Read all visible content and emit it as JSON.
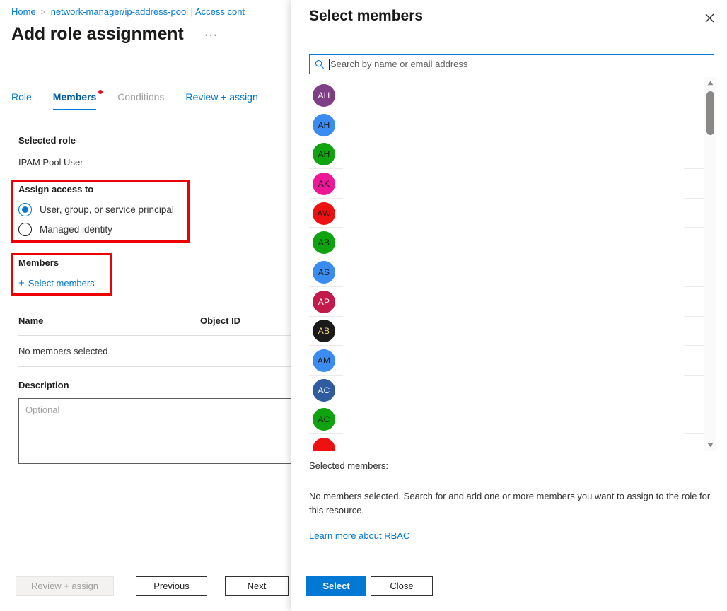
{
  "base_blade": {
    "breadcrumb": {
      "home": "Home",
      "separator": ">",
      "current": "network-manager/ip-address-pool | Access cont"
    },
    "title": "Add role assignment",
    "ellipsis": "···",
    "tabs": [
      {
        "label": "Role",
        "state": "enabled"
      },
      {
        "label": "Members",
        "state": "active"
      },
      {
        "label": "Conditions",
        "state": "disabled"
      },
      {
        "label": "Review + assign",
        "state": "enabled"
      }
    ],
    "selected_role": {
      "heading": "Selected role",
      "value": "IPAM Pool User"
    },
    "assign_access_to": {
      "heading": "Assign access to",
      "options": [
        {
          "label": "User, group, or service principal",
          "selected": true
        },
        {
          "label": "Managed identity",
          "selected": false
        }
      ]
    },
    "members_section": {
      "heading": "Members",
      "add_link": "Select members",
      "plus": "+"
    },
    "members_table": {
      "columns": [
        "Name",
        "Object ID"
      ],
      "empty_text": "No members selected"
    },
    "description": {
      "label": "Description",
      "placeholder": "Optional",
      "value": ""
    },
    "footer": {
      "review_assign": "Review + assign",
      "previous": "Previous",
      "next": "Next"
    }
  },
  "flyout": {
    "title": "Select members",
    "close_icon": "close-icon",
    "search": {
      "placeholder": "Search by name or email address",
      "value": ""
    },
    "people": [
      {
        "initials": "AH",
        "color": "#7e3f86",
        "text_color": "#ffffff"
      },
      {
        "initials": "AH",
        "color": "#3b8cf0",
        "text_color": "#1b1a19"
      },
      {
        "initials": "AH",
        "color": "#0fa30f",
        "text_color": "#1b1a19"
      },
      {
        "initials": "AK",
        "color": "#ee1798",
        "text_color": "#1b1a19"
      },
      {
        "initials": "AW",
        "color": "#ef1111",
        "text_color": "#1b1a19"
      },
      {
        "initials": "AB",
        "color": "#0fa30f",
        "text_color": "#1b1a19"
      },
      {
        "initials": "AS",
        "color": "#3b8cf0",
        "text_color": "#1b1a19"
      },
      {
        "initials": "AP",
        "color": "#c3194b",
        "text_color": "#ffffff"
      },
      {
        "initials": "AB",
        "color": "#1a1a1a",
        "text_color": "#f3d48a"
      },
      {
        "initials": "AM",
        "color": "#3b8cf0",
        "text_color": "#1b1a19"
      },
      {
        "initials": "AC",
        "color": "#2f5c9e",
        "text_color": "#ffffff"
      },
      {
        "initials": "AC",
        "color": "#0fa30f",
        "text_color": "#1b1a19"
      },
      {
        "initials": "",
        "color": "#ef1111",
        "text_color": "#ffffff"
      }
    ],
    "selected_members_label": "Selected members:",
    "selected_members_body": "No members selected. Search for and add one or more members you want to assign to the role for this resource.",
    "learn_more": "Learn more about RBAC",
    "footer": {
      "select": "Select",
      "close": "Close"
    }
  },
  "annotations": {
    "highlight_color": "#ec0000",
    "boxes": [
      "assign-access-to-group",
      "members-group"
    ]
  }
}
